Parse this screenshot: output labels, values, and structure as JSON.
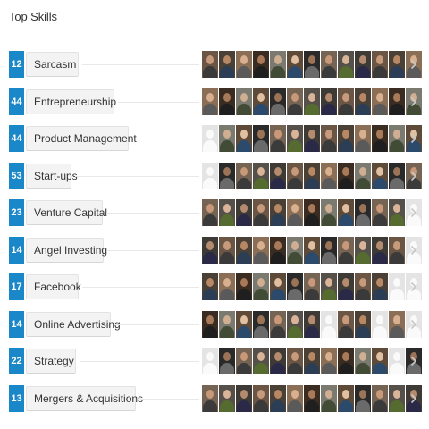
{
  "section": {
    "title": "Top Skills"
  },
  "skills": [
    {
      "count": "12",
      "name": "Sarcasm"
    },
    {
      "count": "44",
      "name": "Entrepreneurship"
    },
    {
      "count": "44",
      "name": "Product Management"
    },
    {
      "count": "53",
      "name": "Start-ups"
    },
    {
      "count": "23",
      "name": "Venture Capital"
    },
    {
      "count": "14",
      "name": "Angel Investing"
    },
    {
      "count": "17",
      "name": "Facebook"
    },
    {
      "count": "14",
      "name": "Online Advertising"
    },
    {
      "count": "22",
      "name": "Strategy"
    },
    {
      "count": "13",
      "name": "Mergers & Acquisitions"
    }
  ],
  "endorser_avatar_icon": "endorser-photo",
  "placeholder_avatar_icon": "default-person-icon",
  "more_icon": "chevron-right-icon",
  "colors": {
    "count_badge": "#1a87c9",
    "pill_bg": "#f3f3f3",
    "chevron": "#c8c8c8"
  }
}
